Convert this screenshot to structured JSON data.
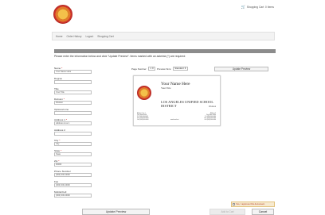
{
  "header": {
    "logo_icon": "district-seal-icon",
    "cart_icon": "shopping-cart-icon",
    "cart_label": "Shopping Cart",
    "cart_count": "0 Items"
  },
  "nav": {
    "items": [
      "Home",
      "Order History",
      "Logout",
      "Shopping Cart"
    ]
  },
  "instructions": "Please enter the information below and click \"Update Preview\". Items marked with an asterisk (*) are required:",
  "form": {
    "fields": [
      {
        "label": "Name",
        "required": true,
        "value": "Your Name Here"
      },
      {
        "label": "Degree",
        "required": false,
        "value": ""
      },
      {
        "label": "Title",
        "required": false,
        "value": "Your Title"
      },
      {
        "label": "Division",
        "required": true,
        "value": "Division"
      },
      {
        "label": "Optional Line",
        "required": false,
        "value": ""
      },
      {
        "label": "Address 1",
        "required": true,
        "value": "Address Line 1"
      },
      {
        "label": "Address 2",
        "required": false,
        "value": ""
      },
      {
        "label": "City",
        "required": true,
        "value": "City"
      },
      {
        "label": "State",
        "required": true,
        "value": "State"
      },
      {
        "label": "Zip",
        "required": true,
        "value": "00000"
      },
      {
        "label": "Phone Number",
        "required": false,
        "value": "(000) 000-0000"
      },
      {
        "label": "Fax",
        "required": false,
        "value": "(000) 000-0000"
      },
      {
        "label": "Mobile/Cell",
        "required": false,
        "value": "(000) 000-0000"
      }
    ]
  },
  "preview_controls": {
    "page_number_label": "Page Number:",
    "page_number_value": "1",
    "preview_size_label": "Preview Size:",
    "preview_size_value": "Standard",
    "update_label": "Update Preview"
  },
  "card": {
    "name": "Your Name Here",
    "title": "Your Title",
    "org": "LOS ANGELES UNIFIED SCHOOL DISTRICT",
    "division": "Division",
    "left_lines": [
      "Address Line 1",
      "City, State 00000",
      "Tel: (000) 000-0000",
      "Fax: (000) 000-0000",
      "Cell: (000) 000-0000"
    ],
    "right_lines": [
      "Address 2",
      "City, State 00000",
      "Tel: (000) 000-0000",
      "Fax: (000) 000-0000",
      "Cell: (000) 000-0000"
    ],
    "website": "www.lausd.net"
  },
  "actions": {
    "approve_label": "Yes, I approve this document.",
    "update_label": "Update Preview",
    "add_to_cart_label": "Add to Cart",
    "cancel_label": "Cancel"
  }
}
